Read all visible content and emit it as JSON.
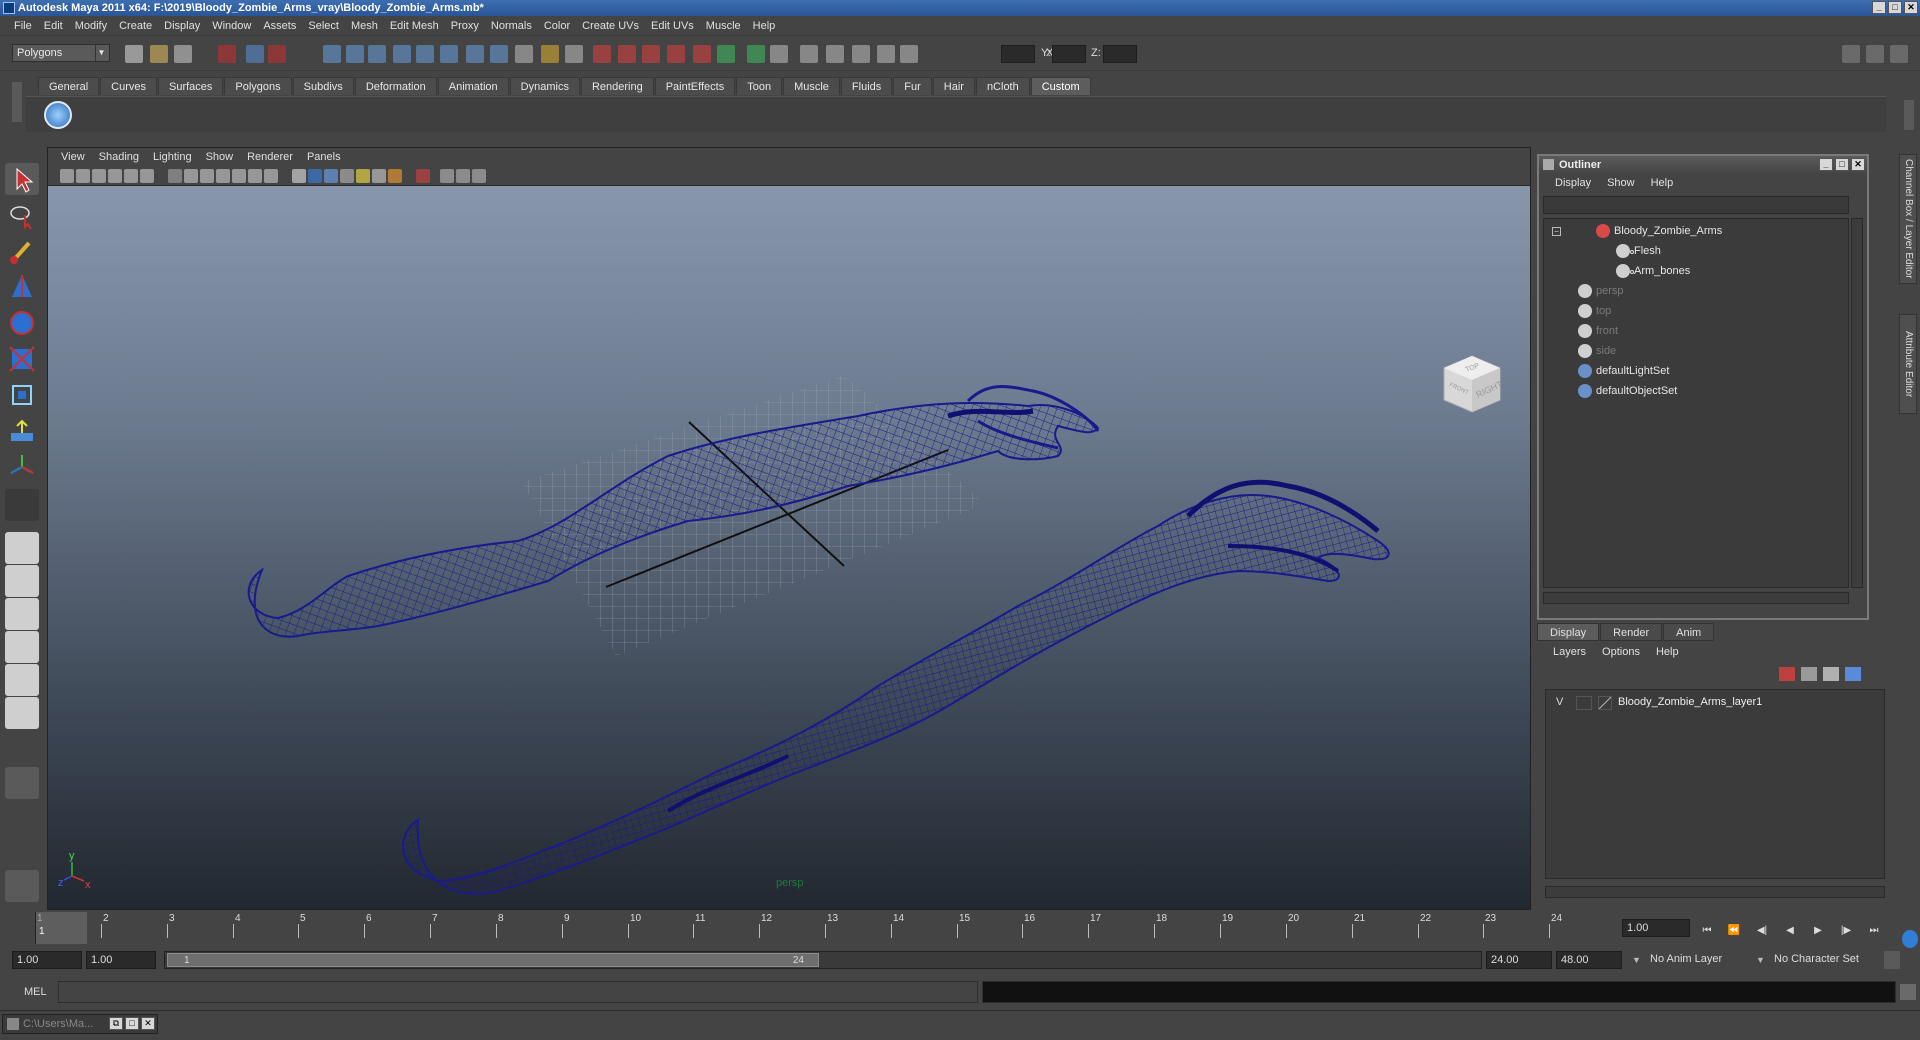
{
  "window": {
    "title": "Autodesk Maya 2011 x64: F:\\2019\\Bloody_Zombie_Arms_vray\\Bloody_Zombie_Arms.mb*"
  },
  "menubar": [
    "File",
    "Edit",
    "Modify",
    "Create",
    "Display",
    "Window",
    "Assets",
    "Select",
    "Mesh",
    "Edit Mesh",
    "Proxy",
    "Normals",
    "Color",
    "Create UVs",
    "Edit UVs",
    "Muscle",
    "Help"
  ],
  "statusline": {
    "mode": "Polygons",
    "x_label": "X:",
    "y_label": "Y:",
    "z_label": "Z:"
  },
  "shelf": {
    "tabs": [
      "General",
      "Curves",
      "Surfaces",
      "Polygons",
      "Subdivs",
      "Deformation",
      "Animation",
      "Dynamics",
      "Rendering",
      "PaintEffects",
      "Toon",
      "Muscle",
      "Fluids",
      "Fur",
      "Hair",
      "nCloth",
      "Custom"
    ],
    "active_tab": "Custom"
  },
  "viewport": {
    "menus": [
      "View",
      "Shading",
      "Lighting",
      "Show",
      "Renderer",
      "Panels"
    ],
    "camera_label": "persp",
    "viewcube": {
      "top": "TOP",
      "right": "RIGHT",
      "front": "FRONT"
    },
    "axis": {
      "y": "y",
      "x": "x",
      "z": "z"
    },
    "wire_color": "#1a1a8c"
  },
  "outliner": {
    "title": "Outliner",
    "menus": [
      "Display",
      "Show",
      "Help"
    ],
    "items": [
      {
        "label": "Bloody_Zombie_Arms",
        "dim": false
      },
      {
        "label": "Flesh",
        "dim": false
      },
      {
        "label": "Arm_bones",
        "dim": false
      },
      {
        "label": "persp",
        "dim": true
      },
      {
        "label": "top",
        "dim": true
      },
      {
        "label": "front",
        "dim": true
      },
      {
        "label": "side",
        "dim": true
      },
      {
        "label": "defaultLightSet",
        "dim": false
      },
      {
        "label": "defaultObjectSet",
        "dim": false
      }
    ]
  },
  "layer_editor": {
    "tabs": [
      "Display",
      "Render",
      "Anim"
    ],
    "active_tab": "Display",
    "menus": [
      "Layers",
      "Options",
      "Help"
    ],
    "layers": [
      {
        "visible": "V",
        "name": "Bloody_Zombie_Arms_layer1"
      }
    ]
  },
  "side_tabs": {
    "channel_box": "Channel Box / Layer Editor",
    "attribute_editor": "Attribute Editor"
  },
  "timeline": {
    "frames": [
      "1",
      "2",
      "3",
      "4",
      "5",
      "6",
      "7",
      "8",
      "9",
      "10",
      "11",
      "12",
      "13",
      "14",
      "15",
      "16",
      "17",
      "18",
      "19",
      "20",
      "21",
      "22",
      "23",
      "24"
    ],
    "current_frame": "1",
    "current_time": "1.00"
  },
  "range": {
    "start": "1.00",
    "inner_start": "1.00",
    "range_start_label": "1",
    "range_end_label": "24",
    "end": "24.00",
    "outer_end": "48.00",
    "anim_layer": "No Anim Layer",
    "character_set": "No Character Set"
  },
  "cmdline": {
    "label": "MEL"
  },
  "taskbar": {
    "item": "C:\\Users\\Ma..."
  }
}
